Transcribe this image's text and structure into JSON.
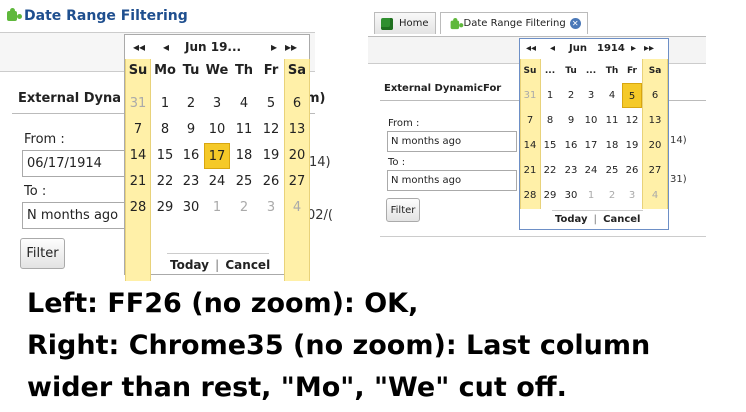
{
  "left": {
    "page_title": "Date Range Filtering",
    "section_title": "External Dyna",
    "section_title_tail": "m)",
    "from_label": "From :",
    "from_value": "06/17/1914",
    "from_tail": "14)",
    "to_label": "To :",
    "to_value": "N months ago",
    "to_tail": "02/(",
    "filter_label": "Filter",
    "calendar": {
      "prev_year": "◂◂",
      "prev_month": "◂",
      "month_year": "Jun  19...",
      "next_month": "▸",
      "next_year": "▸▸",
      "weekdays": [
        "Su",
        "Mo",
        "Tu",
        "We",
        "Th",
        "Fr",
        "Sa"
      ],
      "weeks": [
        [
          "31",
          "1",
          "2",
          "3",
          "4",
          "5",
          "6"
        ],
        [
          "7",
          "8",
          "9",
          "10",
          "11",
          "12",
          "13"
        ],
        [
          "14",
          "15",
          "16",
          "17",
          "18",
          "19",
          "20"
        ],
        [
          "21",
          "22",
          "23",
          "24",
          "25",
          "26",
          "27"
        ],
        [
          "28",
          "29",
          "30",
          "1",
          "2",
          "3",
          "4"
        ]
      ],
      "selected_day": "17",
      "today_label": "Today",
      "cancel_label": "Cancel"
    }
  },
  "right": {
    "tabs": [
      "Home",
      "Date Range Filtering"
    ],
    "section_title": "External DynamicFor",
    "from_label": "From :",
    "from_value": "N months ago",
    "from_tail": "14)",
    "to_label": "To :",
    "to_value": "N months ago",
    "to_tail": "31)",
    "filter_label": "Filter",
    "calendar": {
      "prev_year": "◂◂",
      "prev_month": "◂",
      "month": "Jun",
      "year": "1914",
      "next_month": "▸",
      "next_year": "▸▸",
      "weekdays": [
        "Su",
        "...",
        "Tu",
        "...",
        "Th",
        "Fr",
        "Sa"
      ],
      "weeks": [
        [
          "31",
          "1",
          "2",
          "3",
          "4",
          "5",
          "6"
        ],
        [
          "7",
          "8",
          "9",
          "10",
          "11",
          "12",
          "13"
        ],
        [
          "14",
          "15",
          "16",
          "17",
          "18",
          "19",
          "20"
        ],
        [
          "21",
          "22",
          "23",
          "24",
          "25",
          "26",
          "27"
        ],
        [
          "28",
          "29",
          "30",
          "1",
          "2",
          "3",
          "4"
        ]
      ],
      "selected_day": "5",
      "today_label": "Today",
      "cancel_label": "Cancel"
    }
  },
  "caption": [
    "Left: FF26 (no zoom): OK,",
    "Right: Chrome35 (no zoom): Last column",
    "wider than rest, \"Mo\", \"We\" cut off."
  ],
  "colors": {
    "weekend_column": "#fff0a8",
    "selected_day": "#f5c928",
    "title_blue": "#1f4f8f",
    "puzzle_green": "#5fb83c"
  }
}
